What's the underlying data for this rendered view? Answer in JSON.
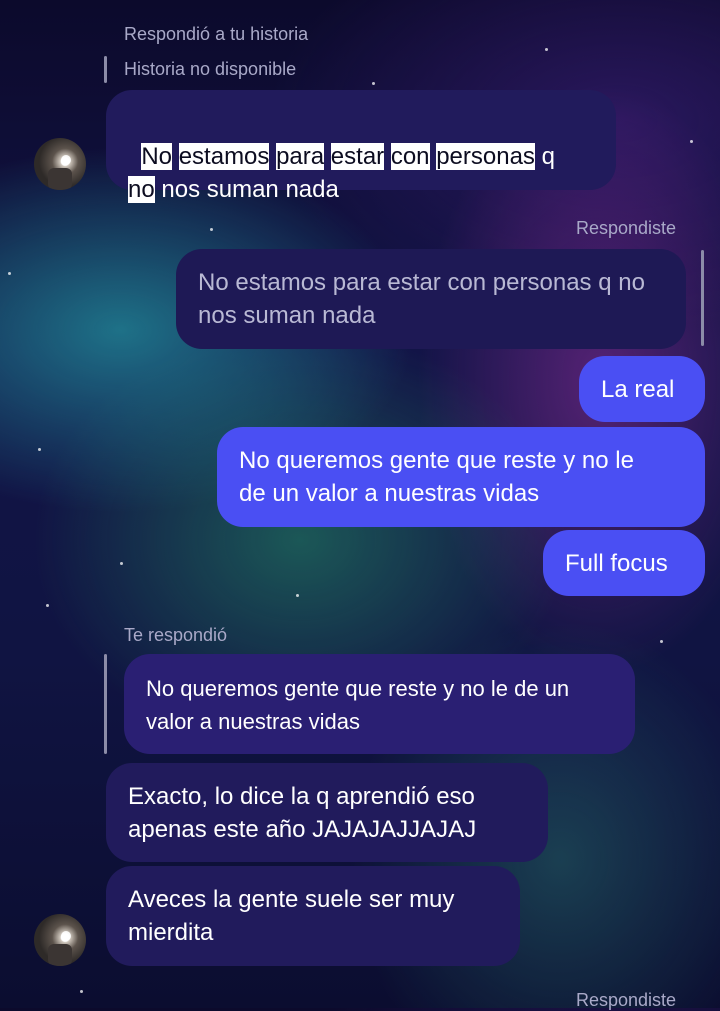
{
  "labels": {
    "replied_to_story": "Respondió a tu historia",
    "story_unavailable": "Historia no disponible",
    "you_replied_1": "Respondiste",
    "they_replied": "Te respondió",
    "you_replied_2": "Respondiste"
  },
  "messages": {
    "m1": {
      "words": [
        "No",
        "estamos",
        "para",
        "estar",
        "con",
        "personas"
      ],
      "tail": "q",
      "line2_hl": "no",
      "line2_rest": "nos suman nada"
    },
    "m2_quote": "No estamos para estar con personas q no\nnos suman nada",
    "m3": "La real",
    "m4": "No queremos gente que reste y no le\nde un valor a nuestras vidas",
    "m5": "Full focus",
    "m6_quote": "No queremos gente que reste y no le de un\nvalor a nuestras vidas",
    "m7": "Exacto, lo dice la q aprendió eso\napenas este año JAJAJAJJAJAJ",
    "m8": "Aveces la gente suele ser muy\nmierdita"
  },
  "icons": {
    "avatar_1": "user-avatar-icon",
    "avatar_2": "user-avatar-icon"
  },
  "colors": {
    "sent_bubble": "#4a4ff3",
    "received_bubble": "#211b5c",
    "label_text": "#a9a9c8"
  }
}
